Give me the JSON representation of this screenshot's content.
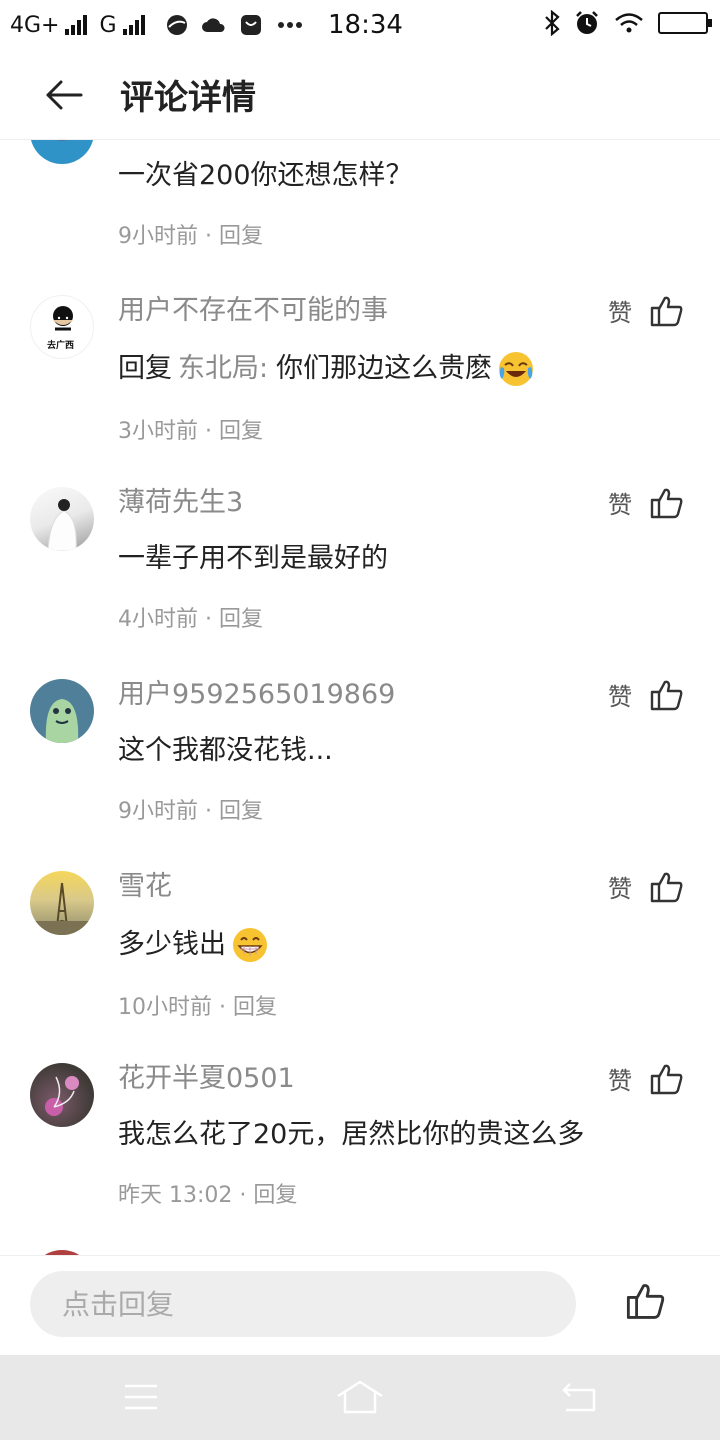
{
  "status_bar": {
    "network1": "4G+",
    "network2": "G",
    "time": "18:34"
  },
  "header": {
    "title": "评论详情"
  },
  "first_comment": {
    "text": "一次省200你还想怎样？",
    "time": "9小时前",
    "reply_label": "回复"
  },
  "comments": [
    {
      "user": "用户不存在不可能的事",
      "reply_prefix": "回复",
      "reply_to": "东北局:",
      "text": "你们那边这么贵麽",
      "emoji": "crying-laughing",
      "time": "3小时前",
      "reply_label": "回复",
      "like_label": "赞",
      "avatar_text": "去广西"
    },
    {
      "user": "薄荷先生3",
      "text": "一辈子用不到是最好的",
      "time": "4小时前",
      "reply_label": "回复",
      "like_label": "赞"
    },
    {
      "user": "用户9592565019869",
      "text": "这个我都没花钱...",
      "time": "9小时前",
      "reply_label": "回复",
      "like_label": "赞"
    },
    {
      "user": "雪花",
      "text": "多少钱出",
      "emoji": "grin",
      "time": "10小时前",
      "reply_label": "回复",
      "like_label": "赞"
    },
    {
      "user": "花开半夏0501",
      "text": "我怎么花了20元，居然比你的贵这么多",
      "time": "昨天 13:02",
      "reply_label": "回复",
      "like_label": "赞"
    }
  ],
  "input_bar": {
    "placeholder": "点击回复"
  },
  "icons": {
    "back": "back-arrow-icon",
    "like": "thumbs-up-icon",
    "menu": "menu-icon",
    "home": "home-icon",
    "return": "return-icon"
  },
  "colors": {
    "meta": "#999999",
    "username": "#8a8a8a",
    "nav_bg": "#e8e8e8",
    "input_bg": "#eeeeee"
  }
}
